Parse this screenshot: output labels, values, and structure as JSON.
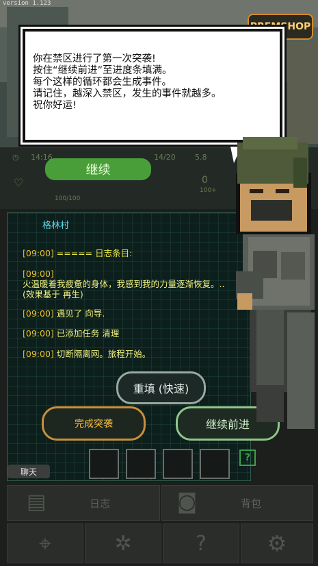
{
  "version": "version 1.123",
  "shop_label": "PREMSHOP",
  "dialog": {
    "text": "你在禁区进行了第一次突袭!\n按住“继续前进”至进度条填满。\n每个这样的循环都会生成事件。\n请记住，越深入禁区，发生的事件就越多。\n祝你好运!"
  },
  "continue_label": "继续",
  "status": {
    "left_stat": "14:16",
    "mid_stat": "14/20",
    "right_stat": "5.8",
    "counter": "0",
    "ammo": "100+",
    "hp": "100/100"
  },
  "location": "格林村",
  "log": [
    {
      "time": "[09:00]",
      "text": "===== 日志条目:"
    },
    {
      "time": "[09:00]",
      "text": "火温暖着我疲惫的身体，我感到我的力量逐渐恢复。.. (效果基于 再生)"
    },
    {
      "time": "[09:00]",
      "text": "遇见了 向导."
    },
    {
      "time": "[09:00]",
      "text": "已添加任务 清理"
    },
    {
      "time": "[09:00]",
      "text": "切断隔离网。旅程开始。"
    }
  ],
  "buttons": {
    "refill": "重填 (快速)",
    "finish": "完成突袭",
    "advance": "继续前进"
  },
  "help": "?",
  "chat": "聊天",
  "nav": {
    "log": "日志",
    "backpack": "背包"
  },
  "colors": {
    "accent_green": "#4a9e3a",
    "log_yellow": "#e8e84a",
    "location_cyan": "#5ad8e8",
    "finish_orange": "#c8903a"
  },
  "icons": [
    "book-icon",
    "backpack-icon",
    "map-pin-icon",
    "camp-icon",
    "map-question-icon",
    "gear-icon"
  ]
}
